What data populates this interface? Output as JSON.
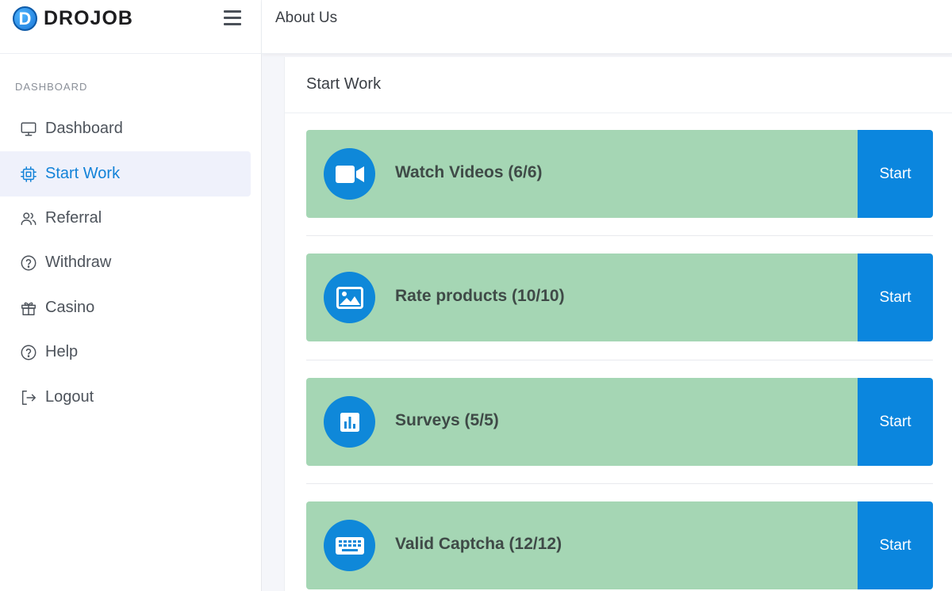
{
  "brand": {
    "badge": "D",
    "name": "DROJOB"
  },
  "topbar": {
    "about_label": "About Us"
  },
  "sidebar": {
    "section_title": "DASHBOARD",
    "items": [
      {
        "label": "Dashboard",
        "icon": "monitor-icon",
        "active": false
      },
      {
        "label": "Start Work",
        "icon": "cpu-icon",
        "active": true
      },
      {
        "label": "Referral",
        "icon": "users-icon",
        "active": false
      },
      {
        "label": "Withdraw",
        "icon": "help-circle-icon",
        "active": false
      },
      {
        "label": "Casino",
        "icon": "gift-icon",
        "active": false
      },
      {
        "label": "Help",
        "icon": "help-circle-icon",
        "active": false
      },
      {
        "label": "Logout",
        "icon": "logout-icon",
        "active": false
      }
    ]
  },
  "main": {
    "title": "Start Work",
    "tasks": [
      {
        "title": "Watch Videos (6/6)",
        "icon": "video-camera-icon",
        "button": "Start"
      },
      {
        "title": "Rate products (10/10)",
        "icon": "image-icon",
        "button": "Start"
      },
      {
        "title": "Surveys (5/5)",
        "icon": "bar-chart-icon",
        "button": "Start"
      },
      {
        "title": "Valid Captcha (12/12)",
        "icon": "keyboard-icon",
        "button": "Start"
      }
    ]
  },
  "colors": {
    "accent": "#0b86de",
    "task_bg": "#a5d6b4",
    "active_bg": "#eff1fb",
    "active_text": "#1282d8"
  }
}
